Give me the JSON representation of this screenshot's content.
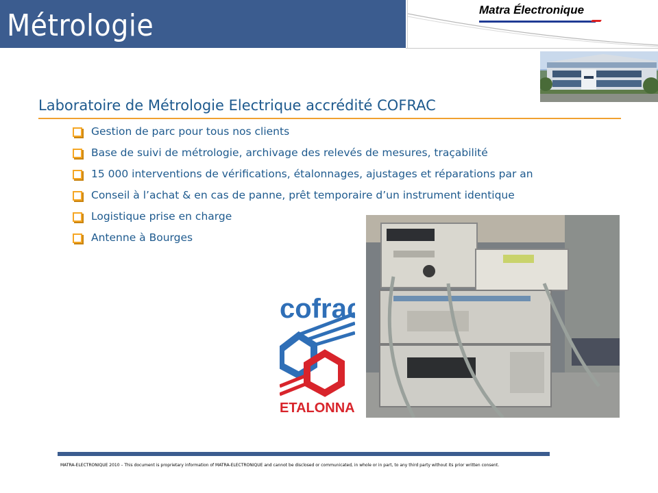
{
  "header": {
    "title": "Métrologie",
    "brand": "Matra Électronique"
  },
  "main": {
    "heading": "Laboratoire de Métrologie Electrique accrédité COFRAC",
    "bullets": [
      "Gestion de parc pour tous nos clients",
      "Base de suivi de métrologie, archivage des relevés de mesures, traçabilité",
      "15 000 interventions de vérifications, étalonnages, ajustages et réparations par an",
      "Conseil à l’achat & en cas de panne, prêt temporaire d’un instrument identique",
      "Logistique prise en charge",
      "Antenne à Bourges"
    ]
  },
  "logo": {
    "word": "cofrac",
    "caption": "ETALONNAGE"
  },
  "footer": {
    "notice": "MATRA-ELECTRONIQUE 2010 – This document is proprietary information of MATRA-ELECTRONIQUE and cannot be disclosed or communicated, in whole or in part, to any third party without its prior written consent."
  },
  "colors": {
    "title_bar": "#3b5c8f",
    "heading_text": "#1e5a8e",
    "accent_rule": "#f0a030",
    "bullet": "#f5a623",
    "cofrac_blue": "#2f6fb7",
    "cofrac_red": "#d8242b"
  }
}
